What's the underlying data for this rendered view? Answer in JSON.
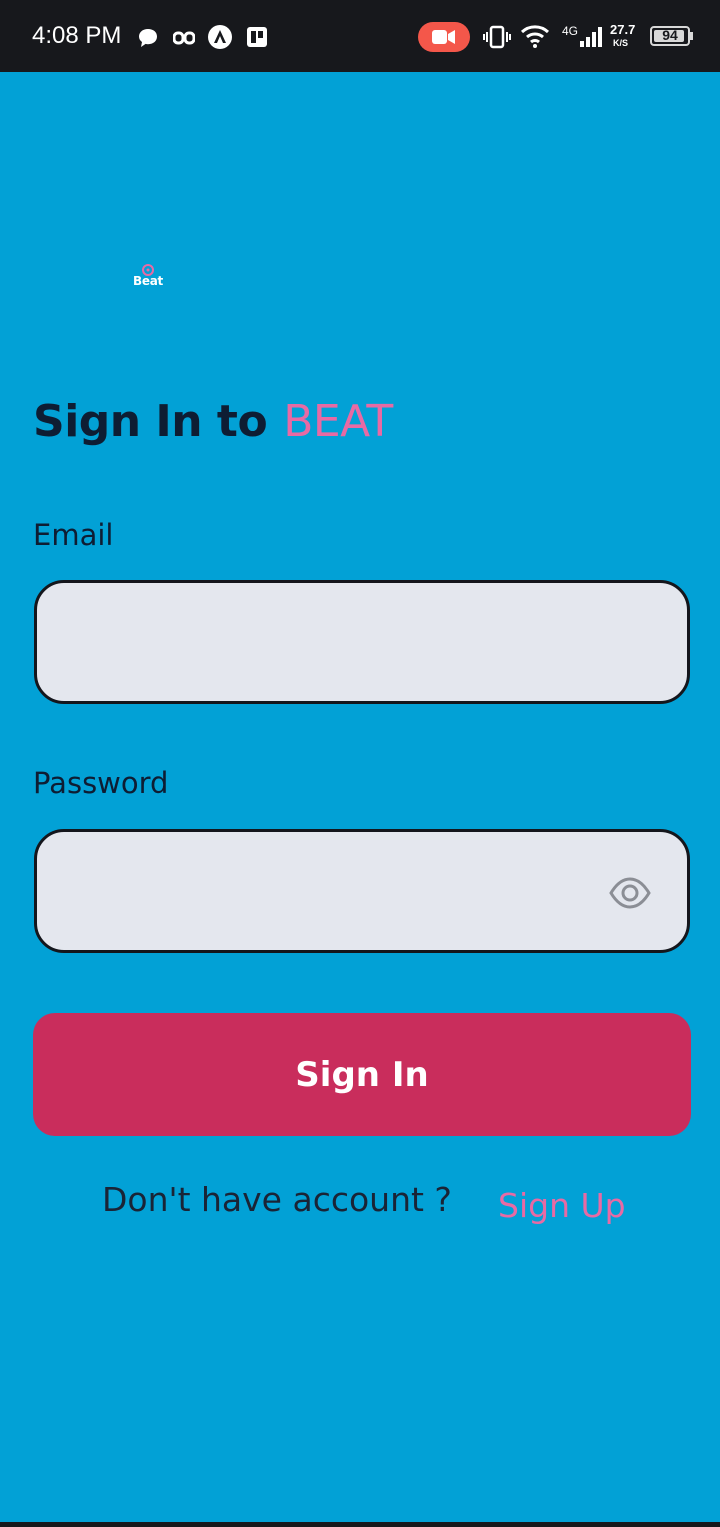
{
  "status_bar": {
    "time": "4:08 PM",
    "network_type": "4G",
    "speed_value": "27.7",
    "speed_unit": "K/S",
    "battery": "94",
    "icons": [
      "message-icon",
      "link-icon",
      "app-a-icon",
      "app-p-icon",
      "screen-record-icon",
      "vibrate-icon",
      "wifi-icon",
      "signal-icon",
      "battery-icon"
    ]
  },
  "logo": {
    "text": "Beat"
  },
  "header": {
    "title_prefix": "Sign In to",
    "title_brand": "BEAT"
  },
  "form": {
    "email_label": "Email",
    "email_value": "",
    "password_label": "Password",
    "password_value": "",
    "sign_in_label": "Sign In"
  },
  "footer": {
    "question": "Don't have account ?",
    "sign_up_label": "Sign Up"
  },
  "colors": {
    "background": "#02a1d6",
    "brand_pink": "#e86aa4",
    "button": "#c92d5c",
    "field_bg": "#e4e7ee",
    "text_dark": "#0e1d33"
  }
}
